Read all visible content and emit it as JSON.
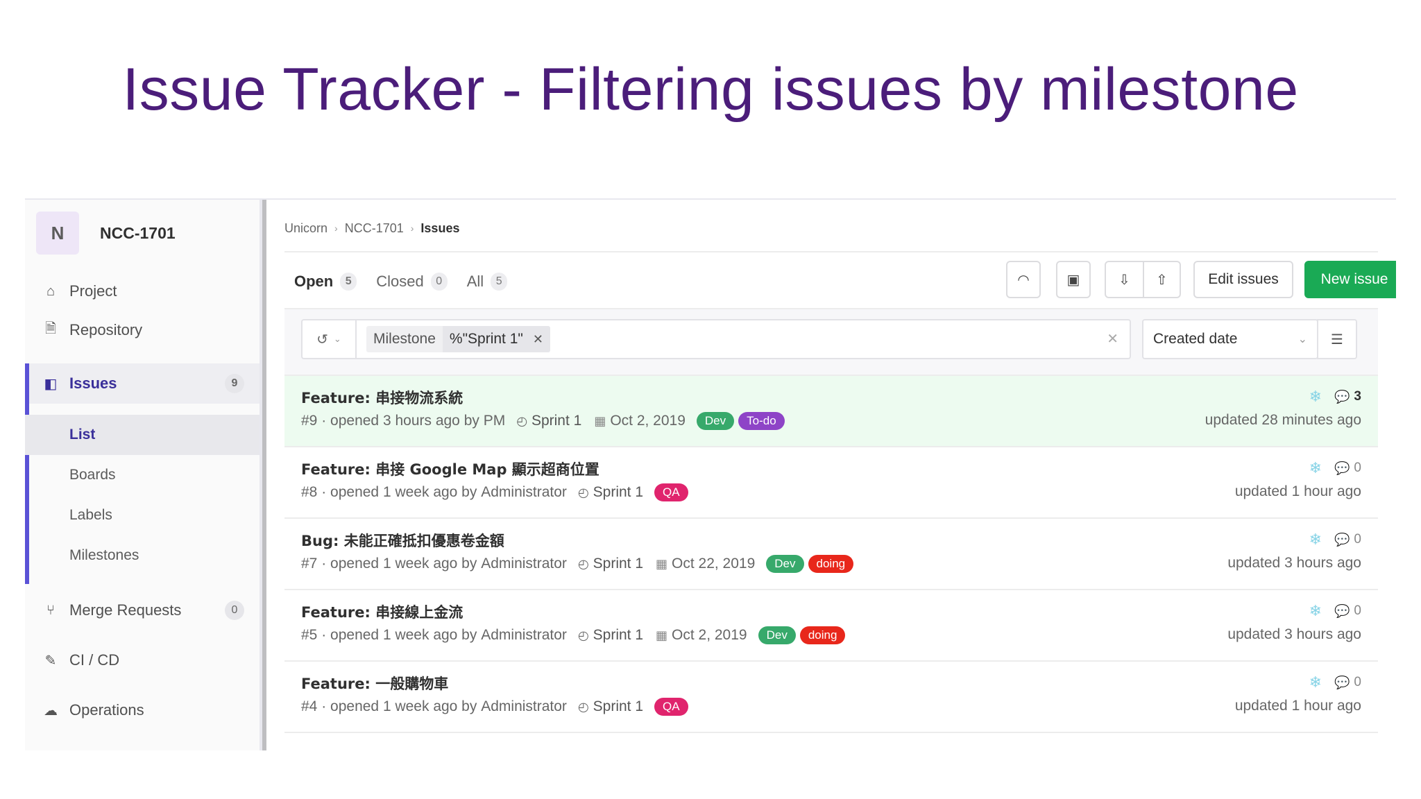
{
  "slide": {
    "title": "Issue Tracker - Filtering issues by milestone"
  },
  "sidebar": {
    "project_initial": "N",
    "project_name": "NCC-1701",
    "items": [
      {
        "label": "Project",
        "icon": "home-icon"
      },
      {
        "label": "Repository",
        "icon": "doc-icon"
      },
      {
        "label": "Issues",
        "icon": "issues-icon",
        "count": "9"
      },
      {
        "label": "Merge Requests",
        "icon": "merge-request-icon",
        "count": "0"
      },
      {
        "label": "CI / CD",
        "icon": "rocket-icon"
      },
      {
        "label": "Operations",
        "icon": "cloud-gear-icon"
      }
    ],
    "sub_items": [
      "List",
      "Boards",
      "Labels",
      "Milestones"
    ]
  },
  "breadcrumb": [
    "Unicorn",
    "NCC-1701",
    "Issues"
  ],
  "tabs": [
    {
      "label": "Open",
      "count": "5"
    },
    {
      "label": "Closed",
      "count": "0"
    },
    {
      "label": "All",
      "count": "5"
    }
  ],
  "actions": {
    "edit": "Edit issues",
    "new": "New issue"
  },
  "filter": {
    "token_name": "Milestone",
    "token_value": "%\"Sprint 1\"",
    "sort": "Created date"
  },
  "colors": {
    "accent": "#6d63e0",
    "new_button": "#1aaa55",
    "label_dev": "#37a96b",
    "label_todo": "#8e44c7",
    "label_qa": "#e0246d",
    "label_doing": "#e8271b"
  },
  "issues": [
    {
      "title": "Feature: 串接物流系統",
      "ref": "#9",
      "opened": "· opened 3 hours ago by",
      "author": "PM",
      "milestone": "Sprint 1",
      "due": "Oct 2, 2019",
      "labels": [
        {
          "text": "Dev",
          "color": "#37a96b"
        },
        {
          "text": "To-do",
          "color": "#8e44c7"
        }
      ],
      "comments": "3",
      "updated": "updated 28 minutes ago"
    },
    {
      "title": "Feature: 串接 Google Map 顯示超商位置",
      "ref": "#8",
      "opened": "· opened 1 week ago by",
      "author": "Administrator",
      "milestone": "Sprint 1",
      "due": "",
      "labels": [
        {
          "text": "QA",
          "color": "#e0246d"
        }
      ],
      "comments": "0",
      "updated": "updated 1 hour ago"
    },
    {
      "title": "Bug: 未能正確抵扣優惠卷金額",
      "ref": "#7",
      "opened": "· opened 1 week ago by",
      "author": "Administrator",
      "milestone": "Sprint 1",
      "due": "Oct 22, 2019",
      "labels": [
        {
          "text": "Dev",
          "color": "#37a96b"
        },
        {
          "text": "doing",
          "color": "#e8271b"
        }
      ],
      "comments": "0",
      "updated": "updated 3 hours ago"
    },
    {
      "title": "Feature: 串接線上金流",
      "ref": "#5",
      "opened": "· opened 1 week ago by",
      "author": "Administrator",
      "milestone": "Sprint 1",
      "due": "Oct 2, 2019",
      "labels": [
        {
          "text": "Dev",
          "color": "#37a96b"
        },
        {
          "text": "doing",
          "color": "#e8271b"
        }
      ],
      "comments": "0",
      "updated": "updated 3 hours ago"
    },
    {
      "title": "Feature: 一般購物車",
      "ref": "#4",
      "opened": "· opened 1 week ago by",
      "author": "Administrator",
      "milestone": "Sprint 1",
      "due": "",
      "labels": [
        {
          "text": "QA",
          "color": "#e0246d"
        }
      ],
      "comments": "0",
      "updated": "updated 1 hour ago"
    }
  ]
}
